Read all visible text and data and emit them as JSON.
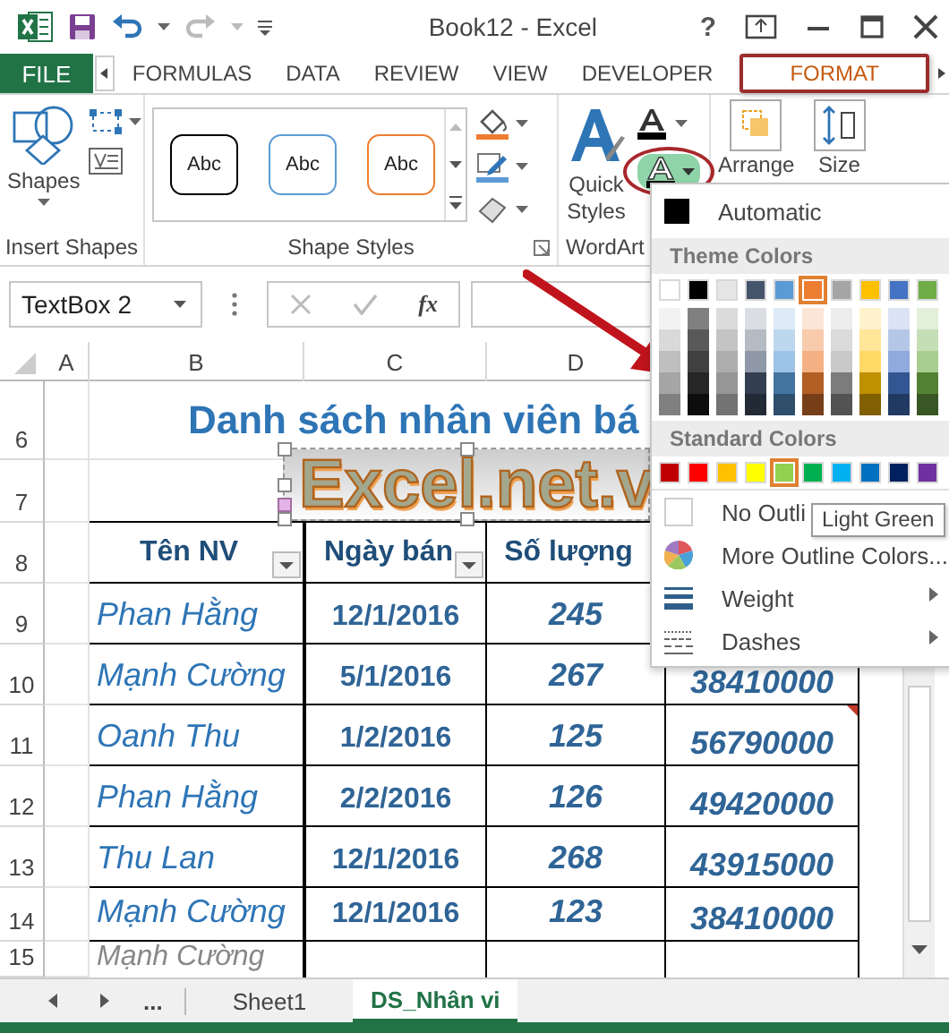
{
  "window": {
    "title": "Book12 - Excel",
    "help": "?"
  },
  "tabs": [
    {
      "label": "FILE",
      "kind": "file",
      "selected": false
    },
    {
      "label": "FORMULAS",
      "kind": "tab",
      "selected": false
    },
    {
      "label": "DATA",
      "kind": "tab",
      "selected": false
    },
    {
      "label": "REVIEW",
      "kind": "tab",
      "selected": false
    },
    {
      "label": "VIEW",
      "kind": "tab",
      "selected": false
    },
    {
      "label": "DEVELOPER",
      "kind": "tab",
      "selected": false
    },
    {
      "label": "FORMAT",
      "kind": "tab",
      "selected": true
    }
  ],
  "ribbon": {
    "insert_shapes": {
      "label": "Insert Shapes",
      "shapes_button": "Shapes"
    },
    "shape_styles": {
      "label": "Shape Styles",
      "styles": [
        {
          "label": "Abc",
          "color": "#000000"
        },
        {
          "label": "Abc",
          "color": "#5b9bd5"
        },
        {
          "label": "Abc",
          "color": "#ed7d31"
        }
      ]
    },
    "wordart": {
      "label": "WordArt",
      "quick_styles": "Quick Styles",
      "text_outline": {
        "selected": true
      }
    },
    "arrange": {
      "label": "Arrange"
    },
    "size": {
      "label": "Size"
    }
  },
  "formula_bar": {
    "name_box": "TextBox 2",
    "function_label": "fx"
  },
  "sheet": {
    "columns": [
      "A",
      "B",
      "C",
      "D"
    ],
    "rows": [
      {
        "number": "6",
        "kind": "title",
        "text": "Danh sách nhân viên bá"
      },
      {
        "number": "7",
        "kind": "blank"
      },
      {
        "number": "8",
        "kind": "header",
        "cells": [
          {
            "text": "Tên NV",
            "filter": true
          },
          {
            "text": "Ngày bán",
            "filter": true
          },
          {
            "text": "Số lượng",
            "filter": false
          }
        ]
      },
      {
        "number": "9",
        "kind": "data",
        "cells": [
          "Phan Hằng",
          "12/1/2016",
          "245"
        ]
      },
      {
        "number": "10",
        "kind": "data",
        "cells": [
          "Mạnh Cường",
          "5/1/2016",
          "267",
          "38410000"
        ]
      },
      {
        "number": "11",
        "kind": "data",
        "comment": true,
        "cells": [
          "Oanh Thu",
          "1/2/2016",
          "125",
          "56790000"
        ]
      },
      {
        "number": "12",
        "kind": "data",
        "comment": false,
        "cells": [
          "Phan Hằng",
          "2/2/2016",
          "126",
          "49420000"
        ]
      },
      {
        "number": "13",
        "kind": "data",
        "comment": false,
        "cells": [
          "Thu Lan",
          "12/1/2016",
          "268",
          "43915000"
        ]
      },
      {
        "number": "14",
        "kind": "data",
        "comment": false,
        "cells": [
          "Mạnh Cường",
          "12/1/2016",
          "123",
          "38410000"
        ]
      },
      {
        "number": "15",
        "kind": "data",
        "comment": false,
        "cells": [
          "Mạnh Cường"
        ]
      }
    ],
    "text_box": {
      "text": "Excel.net.v"
    }
  },
  "menu": {
    "automatic": "Automatic",
    "theme_header": "Theme Colors",
    "theme_colors": [
      {
        "color": "#ffffff",
        "selected": false
      },
      {
        "color": "#000000",
        "selected": false
      },
      {
        "color": "#e7e6e6",
        "selected": false
      },
      {
        "color": "#44546a",
        "selected": false
      },
      {
        "color": "#5b9bd5",
        "selected": false
      },
      {
        "color": "#ed7d31",
        "selected": true
      },
      {
        "color": "#a5a5a5",
        "selected": false
      },
      {
        "color": "#ffc000",
        "selected": false
      },
      {
        "color": "#4472c4",
        "selected": false
      },
      {
        "color": "#70ad47",
        "selected": false
      }
    ],
    "standard_header": "Standard Colors",
    "standard_colors": [
      {
        "color": "#c00000",
        "selected": false
      },
      {
        "color": "#ff0000",
        "selected": false
      },
      {
        "color": "#ffc000",
        "selected": false
      },
      {
        "color": "#ffff00",
        "selected": false
      },
      {
        "color": "#92d050",
        "selected": true
      },
      {
        "color": "#00b050",
        "selected": false
      },
      {
        "color": "#00b0f0",
        "selected": false
      },
      {
        "color": "#0070c0",
        "selected": false
      },
      {
        "color": "#002060",
        "selected": false
      },
      {
        "color": "#7030a0",
        "selected": false
      }
    ],
    "items": [
      {
        "label": "No Outli",
        "kind": "blank"
      },
      {
        "label": "More Outline Colors...",
        "kind": "palette"
      },
      {
        "label": "Weight",
        "kind": "weight"
      },
      {
        "label": "Dashes",
        "kind": "dashes"
      }
    ]
  },
  "tooltip": "Light Green",
  "sheet_tabs": {
    "more": "...",
    "tabs": [
      {
        "label": "Sheet1",
        "selected": false
      },
      {
        "label": "DS_Nhân vi",
        "selected": true
      }
    ]
  }
}
